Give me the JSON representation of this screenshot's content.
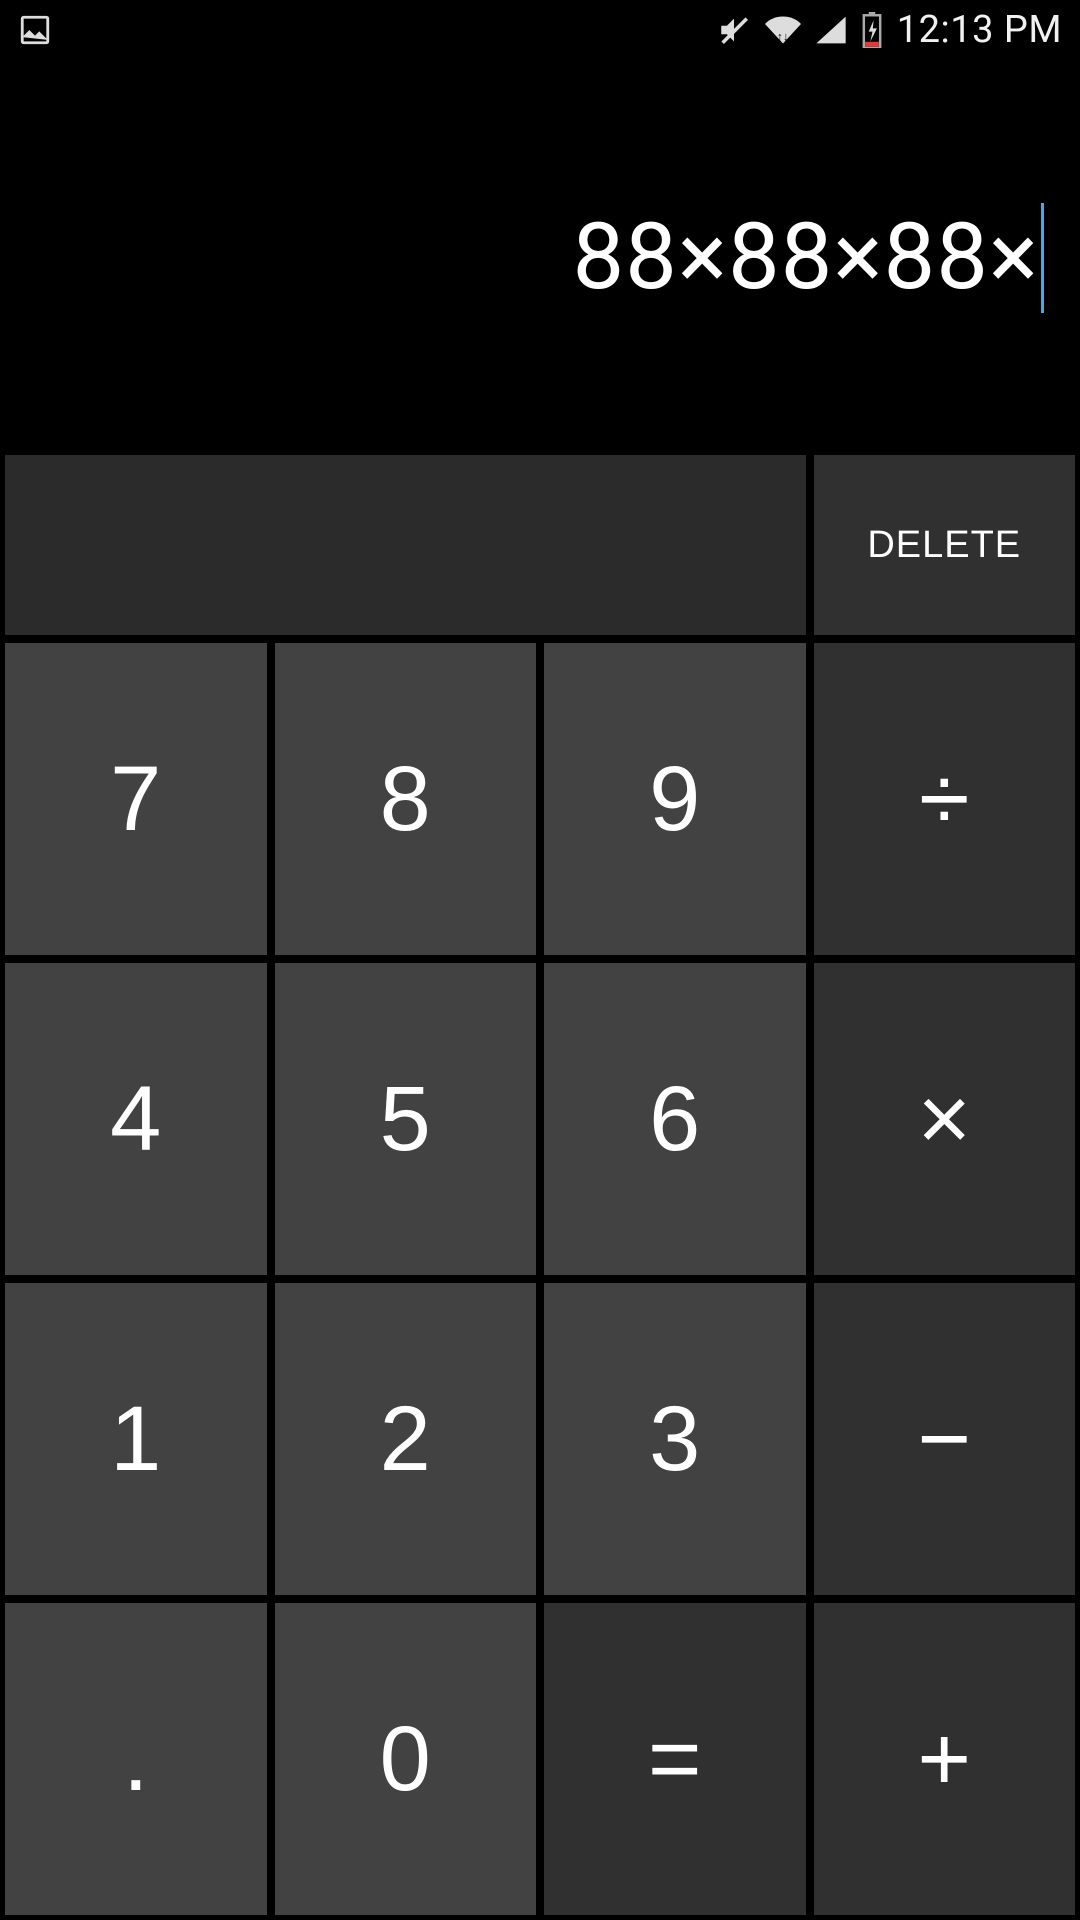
{
  "status": {
    "time": "12:13 PM"
  },
  "display": {
    "expression": "88×88×88×"
  },
  "keys": {
    "delete": "DELETE",
    "d7": "7",
    "d8": "8",
    "d9": "9",
    "d4": "4",
    "d5": "5",
    "d6": "6",
    "d1": "1",
    "d2": "2",
    "d3": "3",
    "d0": "0",
    "dot": ".",
    "equals": "=",
    "divide": "÷",
    "multiply": "×",
    "minus": "−",
    "plus": "+"
  }
}
